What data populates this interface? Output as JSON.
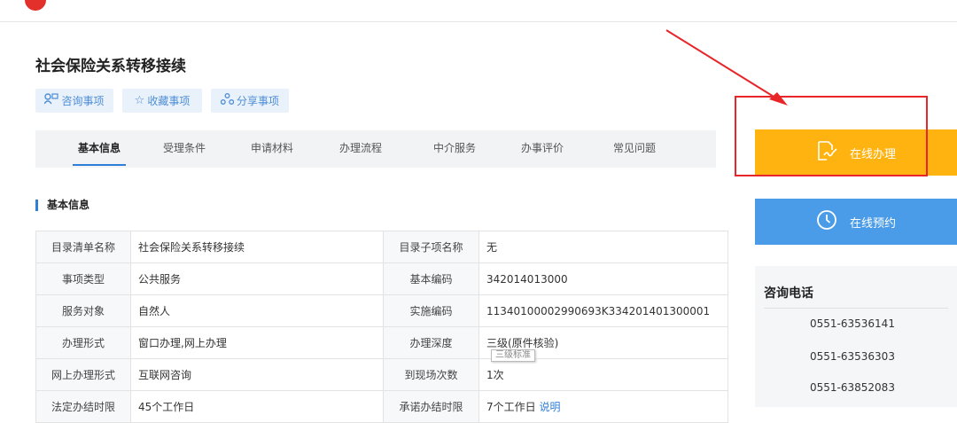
{
  "page": {
    "title": "社会保险关系转移接续",
    "actions": [
      {
        "label": "咨询事项",
        "icon": "consult-icon"
      },
      {
        "label": "收藏事项",
        "icon": "star-icon"
      },
      {
        "label": "分享事项",
        "icon": "share-icon"
      }
    ]
  },
  "tabs": [
    "基本信息",
    "受理条件",
    "申请材料",
    "办理流程",
    "中介服务",
    "办事评价",
    "常见问题"
  ],
  "active_tab": "基本信息",
  "section_title": "基本信息",
  "info_rows": [
    {
      "l1": "目录清单名称",
      "v1": "社会保险关系转移接续",
      "l2": "目录子项名称",
      "v2": "无"
    },
    {
      "l1": "事项类型",
      "v1": "公共服务",
      "l2": "基本编码",
      "v2": "342014013000"
    },
    {
      "l1": "服务对象",
      "v1": "自然人",
      "l2": "实施编码",
      "v2": "11340100002990693K334201401300001"
    },
    {
      "l1": "办理形式",
      "v1": "窗口办理,网上办理",
      "l2": "办理深度",
      "v2": "三级(原件核验)"
    },
    {
      "l1": "网上办理形式",
      "v1": "互联网咨询",
      "l2": "到现场次数",
      "v2": "1次"
    },
    {
      "l1": "法定办结时限",
      "v1": "45个工作日",
      "l2": "承诺办结时限",
      "v2": "7个工作日",
      "v2_link": "说明"
    }
  ],
  "tooltip": "三级标准",
  "sidebar": {
    "online_button": "在线办理",
    "appoint_button": "在线预约",
    "consult_title": "咨询电话",
    "phones": [
      "0551-63536141",
      "0551-63536303",
      "0551-63852083"
    ]
  },
  "colors": {
    "accent_blue": "#2f7fd8",
    "online_orange": "#ffb310",
    "appoint_blue": "#4a9be8",
    "annotation_red": "#e8262a"
  }
}
